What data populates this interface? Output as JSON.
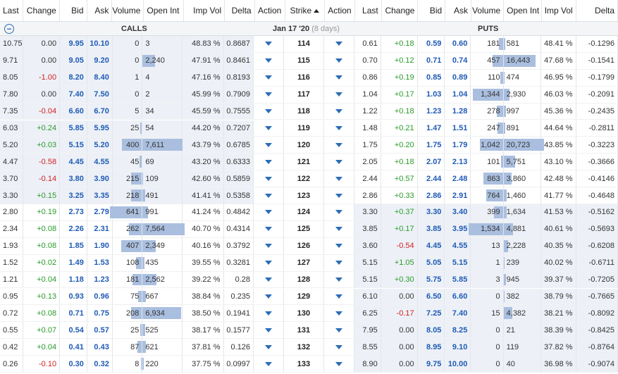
{
  "headers": {
    "calls": [
      "Last",
      "Change",
      "Bid",
      "Ask",
      "Volume",
      "Open Int",
      "Imp Vol",
      "Delta",
      "Action"
    ],
    "strike": "Strike",
    "puts": [
      "Action",
      "Last",
      "Change",
      "Bid",
      "Ask",
      "Volume",
      "Open Int",
      "Imp Vol",
      "Delta"
    ]
  },
  "group": {
    "calls_label": "CALLS",
    "expiry": "Jan 17 '20",
    "days": "(8 days)",
    "puts_label": "PUTS"
  },
  "colors": {
    "bar": "#aabfdf",
    "itm_bg": "#edf1f7",
    "positive": "#2a9a2a",
    "negative": "#d21f1f",
    "link": "#1f5bb5"
  },
  "rows": [
    {
      "strike": "114",
      "c_last": "10.75",
      "c_chg": "0.00",
      "c_bid": "9.95",
      "c_ask": "10.10",
      "c_vol": "0",
      "c_oi": "3",
      "c_iv": "48.83 %",
      "c_delta": "0.8687",
      "p_last": "0.61",
      "p_chg": "+0.18",
      "p_bid": "0.59",
      "p_ask": "0.60",
      "p_vol": "181",
      "p_oi": "581",
      "p_iv": "48.41 %",
      "p_delta": "-0.1296"
    },
    {
      "strike": "115",
      "c_last": "9.71",
      "c_chg": "0.00",
      "c_bid": "9.05",
      "c_ask": "9.20",
      "c_vol": "0",
      "c_oi": "2,240",
      "c_iv": "47.91 %",
      "c_delta": "0.8461",
      "p_last": "0.70",
      "p_chg": "+0.12",
      "p_bid": "0.71",
      "p_ask": "0.74",
      "p_vol": "457",
      "p_oi": "16,443",
      "p_iv": "47.68 %",
      "p_delta": "-0.1541"
    },
    {
      "strike": "116",
      "c_last": "8.05",
      "c_chg": "-1.00",
      "c_bid": "8.20",
      "c_ask": "8.40",
      "c_vol": "1",
      "c_oi": "4",
      "c_iv": "47.16 %",
      "c_delta": "0.8193",
      "p_last": "0.86",
      "p_chg": "+0.19",
      "p_bid": "0.85",
      "p_ask": "0.89",
      "p_vol": "110",
      "p_oi": "474",
      "p_iv": "46.95 %",
      "p_delta": "-0.1799"
    },
    {
      "strike": "117",
      "c_last": "7.80",
      "c_chg": "0.00",
      "c_bid": "7.40",
      "c_ask": "7.50",
      "c_vol": "0",
      "c_oi": "2",
      "c_iv": "45.99 %",
      "c_delta": "0.7909",
      "p_last": "1.04",
      "p_chg": "+0.17",
      "p_bid": "1.03",
      "p_ask": "1.04",
      "p_vol": "1,344",
      "p_oi": "2,930",
      "p_iv": "46.03 %",
      "p_delta": "-0.2091"
    },
    {
      "strike": "118",
      "c_last": "7.35",
      "c_chg": "-0.04",
      "c_bid": "6.60",
      "c_ask": "6.70",
      "c_vol": "5",
      "c_oi": "34",
      "c_iv": "45.59 %",
      "c_delta": "0.7555",
      "p_last": "1.22",
      "p_chg": "+0.18",
      "p_bid": "1.23",
      "p_ask": "1.28",
      "p_vol": "278",
      "p_oi": "997",
      "p_iv": "45.36 %",
      "p_delta": "-0.2435"
    },
    {
      "strike": "119",
      "c_last": "6.03",
      "c_chg": "+0.24",
      "c_bid": "5.85",
      "c_ask": "5.95",
      "c_vol": "25",
      "c_oi": "54",
      "c_iv": "44.20 %",
      "c_delta": "0.7207",
      "p_last": "1.48",
      "p_chg": "+0.21",
      "p_bid": "1.47",
      "p_ask": "1.51",
      "p_vol": "247",
      "p_oi": "891",
      "p_iv": "44.64 %",
      "p_delta": "-0.2811"
    },
    {
      "strike": "120",
      "c_last": "5.20",
      "c_chg": "+0.03",
      "c_bid": "5.15",
      "c_ask": "5.20",
      "c_vol": "400",
      "c_oi": "7,611",
      "c_iv": "43.79 %",
      "c_delta": "0.6785",
      "p_last": "1.75",
      "p_chg": "+0.20",
      "p_bid": "1.75",
      "p_ask": "1.79",
      "p_vol": "1,042",
      "p_oi": "20,723",
      "p_iv": "43.85 %",
      "p_delta": "-0.3223"
    },
    {
      "strike": "121",
      "c_last": "4.47",
      "c_chg": "-0.58",
      "c_bid": "4.45",
      "c_ask": "4.55",
      "c_vol": "45",
      "c_oi": "69",
      "c_iv": "43.20 %",
      "c_delta": "0.6333",
      "p_last": "2.05",
      "p_chg": "+0.18",
      "p_bid": "2.07",
      "p_ask": "2.13",
      "p_vol": "101",
      "p_oi": "5,751",
      "p_iv": "43.10 %",
      "p_delta": "-0.3666"
    },
    {
      "strike": "122",
      "c_last": "3.70",
      "c_chg": "-0.14",
      "c_bid": "3.80",
      "c_ask": "3.90",
      "c_vol": "215",
      "c_oi": "109",
      "c_iv": "42.60 %",
      "c_delta": "0.5859",
      "p_last": "2.44",
      "p_chg": "+0.57",
      "p_bid": "2.44",
      "p_ask": "2.48",
      "p_vol": "863",
      "p_oi": "3,860",
      "p_iv": "42.48 %",
      "p_delta": "-0.4146"
    },
    {
      "strike": "123",
      "c_last": "3.30",
      "c_chg": "+0.15",
      "c_bid": "3.25",
      "c_ask": "3.35",
      "c_vol": "218",
      "c_oi": "491",
      "c_iv": "41.41 %",
      "c_delta": "0.5358",
      "p_last": "2.86",
      "p_chg": "+0.33",
      "p_bid": "2.86",
      "p_ask": "2.91",
      "p_vol": "764",
      "p_oi": "1,460",
      "p_iv": "41.77 %",
      "p_delta": "-0.4648"
    },
    {
      "strike": "124",
      "c_last": "2.80",
      "c_chg": "+0.19",
      "c_bid": "2.73",
      "c_ask": "2.79",
      "c_vol": "641",
      "c_oi": "991",
      "c_iv": "41.24 %",
      "c_delta": "0.4842",
      "p_last": "3.30",
      "p_chg": "+0.37",
      "p_bid": "3.30",
      "p_ask": "3.40",
      "p_vol": "399",
      "p_oi": "1,634",
      "p_iv": "41.53 %",
      "p_delta": "-0.5162"
    },
    {
      "strike": "125",
      "c_last": "2.34",
      "c_chg": "+0.08",
      "c_bid": "2.26",
      "c_ask": "2.31",
      "c_vol": "262",
      "c_oi": "7,564",
      "c_iv": "40.70 %",
      "c_delta": "0.4314",
      "p_last": "3.85",
      "p_chg": "+0.17",
      "p_bid": "3.85",
      "p_ask": "3.95",
      "p_vol": "1,534",
      "p_oi": "4,881",
      "p_iv": "40.61 %",
      "p_delta": "-0.5693"
    },
    {
      "strike": "126",
      "c_last": "1.93",
      "c_chg": "+0.08",
      "c_bid": "1.85",
      "c_ask": "1.90",
      "c_vol": "407",
      "c_oi": "2,349",
      "c_iv": "40.16 %",
      "c_delta": "0.3792",
      "p_last": "3.60",
      "p_chg": "-0.54",
      "p_bid": "4.45",
      "p_ask": "4.55",
      "p_vol": "13",
      "p_oi": "2,228",
      "p_iv": "40.35 %",
      "p_delta": "-0.6208"
    },
    {
      "strike": "127",
      "c_last": "1.52",
      "c_chg": "+0.02",
      "c_bid": "1.49",
      "c_ask": "1.53",
      "c_vol": "108",
      "c_oi": "435",
      "c_iv": "39.55 %",
      "c_delta": "0.3281",
      "p_last": "5.15",
      "p_chg": "+1.05",
      "p_bid": "5.05",
      "p_ask": "5.15",
      "p_vol": "1",
      "p_oi": "239",
      "p_iv": "40.02 %",
      "p_delta": "-0.6711"
    },
    {
      "strike": "128",
      "c_last": "1.21",
      "c_chg": "+0.04",
      "c_bid": "1.18",
      "c_ask": "1.23",
      "c_vol": "181",
      "c_oi": "2,562",
      "c_iv": "39.22 %",
      "c_delta": "0.28",
      "p_last": "5.15",
      "p_chg": "+0.30",
      "p_bid": "5.75",
      "p_ask": "5.85",
      "p_vol": "3",
      "p_oi": "945",
      "p_iv": "39.37 %",
      "p_delta": "-0.7205"
    },
    {
      "strike": "129",
      "c_last": "0.95",
      "c_chg": "+0.13",
      "c_bid": "0.93",
      "c_ask": "0.96",
      "c_vol": "75",
      "c_oi": "667",
      "c_iv": "38.84 %",
      "c_delta": "0.235",
      "p_last": "6.10",
      "p_chg": "0.00",
      "p_bid": "6.50",
      "p_ask": "6.60",
      "p_vol": "0",
      "p_oi": "382",
      "p_iv": "38.79 %",
      "p_delta": "-0.7665"
    },
    {
      "strike": "130",
      "c_last": "0.72",
      "c_chg": "+0.08",
      "c_bid": "0.71",
      "c_ask": "0.75",
      "c_vol": "208",
      "c_oi": "6,934",
      "c_iv": "38.50 %",
      "c_delta": "0.1941",
      "p_last": "6.25",
      "p_chg": "-0.17",
      "p_bid": "7.25",
      "p_ask": "7.40",
      "p_vol": "15",
      "p_oi": "4,382",
      "p_iv": "38.21 %",
      "p_delta": "-0.8092"
    },
    {
      "strike": "131",
      "c_last": "0.55",
      "c_chg": "+0.07",
      "c_bid": "0.54",
      "c_ask": "0.57",
      "c_vol": "25",
      "c_oi": "525",
      "c_iv": "38.17 %",
      "c_delta": "0.1577",
      "p_last": "7.95",
      "p_chg": "0.00",
      "p_bid": "8.05",
      "p_ask": "8.25",
      "p_vol": "0",
      "p_oi": "21",
      "p_iv": "38.39 %",
      "p_delta": "-0.8425"
    },
    {
      "strike": "132",
      "c_last": "0.42",
      "c_chg": "+0.04",
      "c_bid": "0.41",
      "c_ask": "0.43",
      "c_vol": "87",
      "c_oi": "621",
      "c_iv": "37.81 %",
      "c_delta": "0.126",
      "p_last": "8.55",
      "p_chg": "0.00",
      "p_bid": "8.95",
      "p_ask": "9.10",
      "p_vol": "0",
      "p_oi": "119",
      "p_iv": "37.82 %",
      "p_delta": "-0.8764"
    },
    {
      "strike": "133",
      "c_last": "0.26",
      "c_chg": "-0.10",
      "c_bid": "0.30",
      "c_ask": "0.32",
      "c_vol": "8",
      "c_oi": "220",
      "c_iv": "37.75 %",
      "c_delta": "0.0997",
      "p_last": "8.90",
      "p_chg": "0.00",
      "p_bid": "9.75",
      "p_ask": "10.00",
      "p_vol": "0",
      "p_oi": "40",
      "p_iv": "36.98 %",
      "p_delta": "-0.9074"
    }
  ]
}
